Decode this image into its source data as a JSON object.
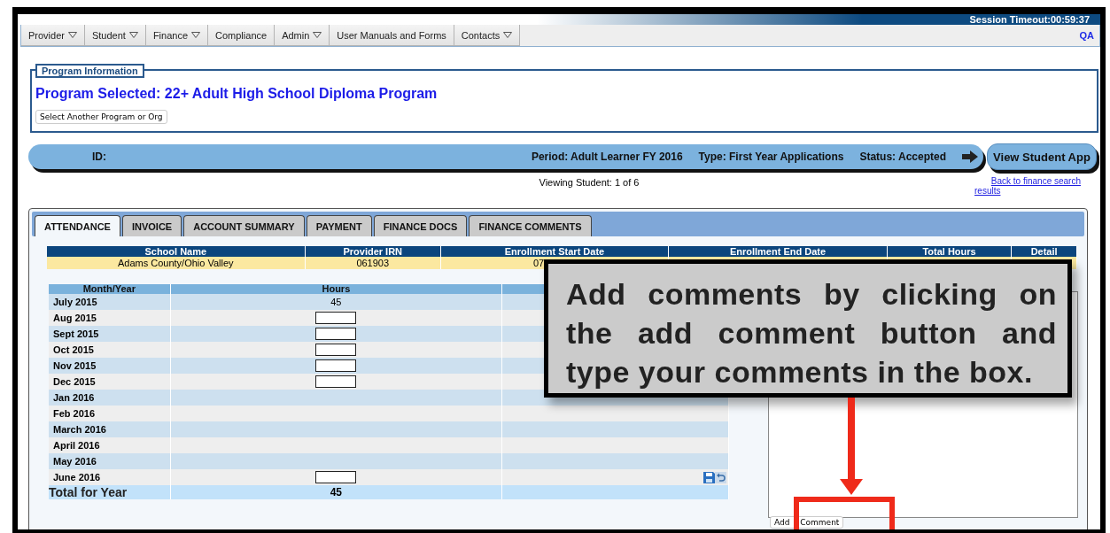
{
  "session_timeout": "Session Timeout:00:59:37",
  "nav": [
    {
      "label": "Provider",
      "dropdown": true
    },
    {
      "label": "Student",
      "dropdown": true
    },
    {
      "label": "Finance",
      "dropdown": true
    },
    {
      "label": "Compliance",
      "dropdown": false
    },
    {
      "label": "Admin",
      "dropdown": true
    },
    {
      "label": "User Manuals and Forms",
      "dropdown": false
    },
    {
      "label": "Contacts",
      "dropdown": true
    }
  ],
  "env_label": "QA",
  "program_info": {
    "legend": "Program Information",
    "title": "Program Selected: 22+ Adult High School Diploma Program",
    "button": "Select Another Program or Org"
  },
  "student_bar": {
    "id_label": "ID:",
    "period": "Period: Adult Learner FY 2016",
    "type": "Type: First Year Applications",
    "status": "Status: Accepted"
  },
  "view_button": "View Student App",
  "viewing": "Viewing Student: 1 of 6",
  "back_link": "Back to finance search results",
  "tabs": [
    {
      "label": "ATTENDANCE",
      "selected": true
    },
    {
      "label": "INVOICE",
      "selected": false
    },
    {
      "label": "ACCOUNT SUMMARY",
      "selected": false
    },
    {
      "label": "PAYMENT",
      "selected": false
    },
    {
      "label": "FINANCE DOCS",
      "selected": false
    },
    {
      "label": "FINANCE COMMENTS",
      "selected": false
    }
  ],
  "school_table": {
    "columns": [
      "School Name",
      "Provider IRN",
      "Enrollment Start Date",
      "Enrollment End Date",
      "Total Hours",
      "Detail"
    ],
    "rows": [
      [
        "Adams County/Ohio Valley",
        "061903",
        "07"
      ]
    ]
  },
  "attendance": {
    "columns": [
      "Month/Year",
      "Hours"
    ],
    "rows": [
      {
        "month": "July 2015",
        "kind": "value",
        "hours": "45"
      },
      {
        "month": "Aug 2015",
        "kind": "input"
      },
      {
        "month": "Sept 2015",
        "kind": "input"
      },
      {
        "month": "Oct 2015",
        "kind": "input"
      },
      {
        "month": "Nov 2015",
        "kind": "input"
      },
      {
        "month": "Dec 2015",
        "kind": "input"
      },
      {
        "month": "Jan 2016",
        "kind": "empty"
      },
      {
        "month": "Feb 2016",
        "kind": "empty"
      },
      {
        "month": "March 2016",
        "kind": "empty"
      },
      {
        "month": "April 2016",
        "kind": "empty"
      },
      {
        "month": "May 2016",
        "kind": "empty"
      },
      {
        "month": "June 2016",
        "kind": "input",
        "actions": true
      }
    ],
    "total": {
      "label": "Total for Year",
      "hours": "45"
    }
  },
  "add_comment_button": "Add Comment",
  "callout": {
    "text": "Add comments by clicking on the add comment button and type your comments in the box."
  }
}
